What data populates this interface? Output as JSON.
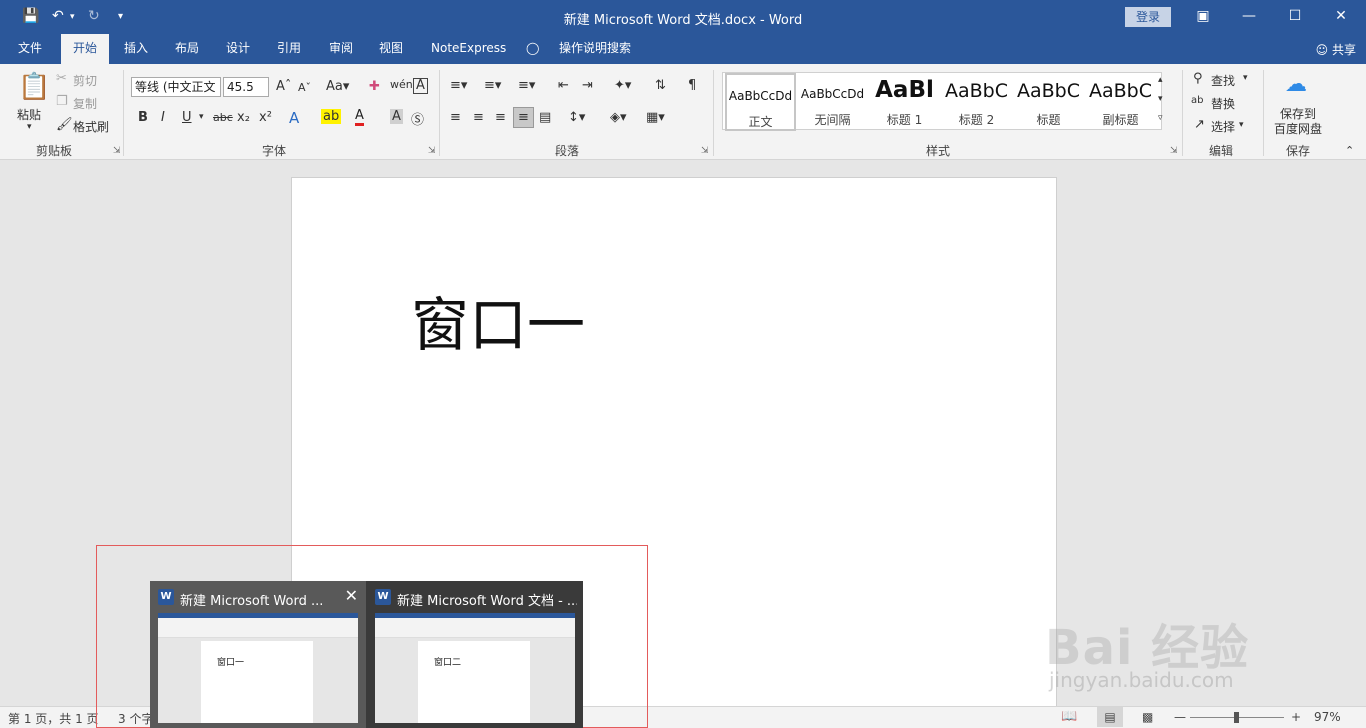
{
  "titlebar": {
    "title": "新建 Microsoft Word 文档.docx  -  Word",
    "login": "登录",
    "save_icon": "save-icon",
    "undo_icon": "undo-icon",
    "redo_icon": "redo-icon",
    "customize_icon": "customize-qa-icon"
  },
  "tabs": [
    "文件",
    "开始",
    "插入",
    "布局",
    "设计",
    "引用",
    "审阅",
    "视图",
    "NoteExpress"
  ],
  "tell_me": "操作说明搜索",
  "share": "共享",
  "ribbon": {
    "clipboard": {
      "paste": "粘贴",
      "cut": "剪切",
      "copy": "复制",
      "format_painter": "格式刷",
      "label": "剪贴板"
    },
    "font": {
      "font_name": "等线 (中文正文",
      "font_size": "45.5",
      "label": "字体"
    },
    "paragraph": {
      "label": "段落"
    },
    "styles": {
      "label": "样式",
      "items": [
        {
          "sample": "AaBbCcDd",
          "name": "正文"
        },
        {
          "sample": "AaBbCcDd",
          "name": "无间隔"
        },
        {
          "sample": "AaBl",
          "name": "标题 1"
        },
        {
          "sample": "AaBbC",
          "name": "标题 2"
        },
        {
          "sample": "AaBbC",
          "name": "标题"
        },
        {
          "sample": "AaBbC",
          "name": "副标题"
        }
      ]
    },
    "editing": {
      "find": "查找",
      "replace": "替换",
      "select": "选择",
      "label": "编辑"
    },
    "save": {
      "line1": "保存到",
      "line2": "百度网盘",
      "label": "保存"
    }
  },
  "document": {
    "text": "窗口一"
  },
  "statusbar": {
    "page": "第 1 页，共 1 页",
    "words": "3 个字",
    "zoom": "97%"
  },
  "taskbar_previews": [
    {
      "title": "新建 Microsoft Word ...",
      "content": "窗口一"
    },
    {
      "title": "新建 Microsoft Word 文档 - ...",
      "content": "窗口二"
    }
  ],
  "watermark": {
    "brand": "Bai  经验",
    "url": "jingyan.baidu.com"
  }
}
